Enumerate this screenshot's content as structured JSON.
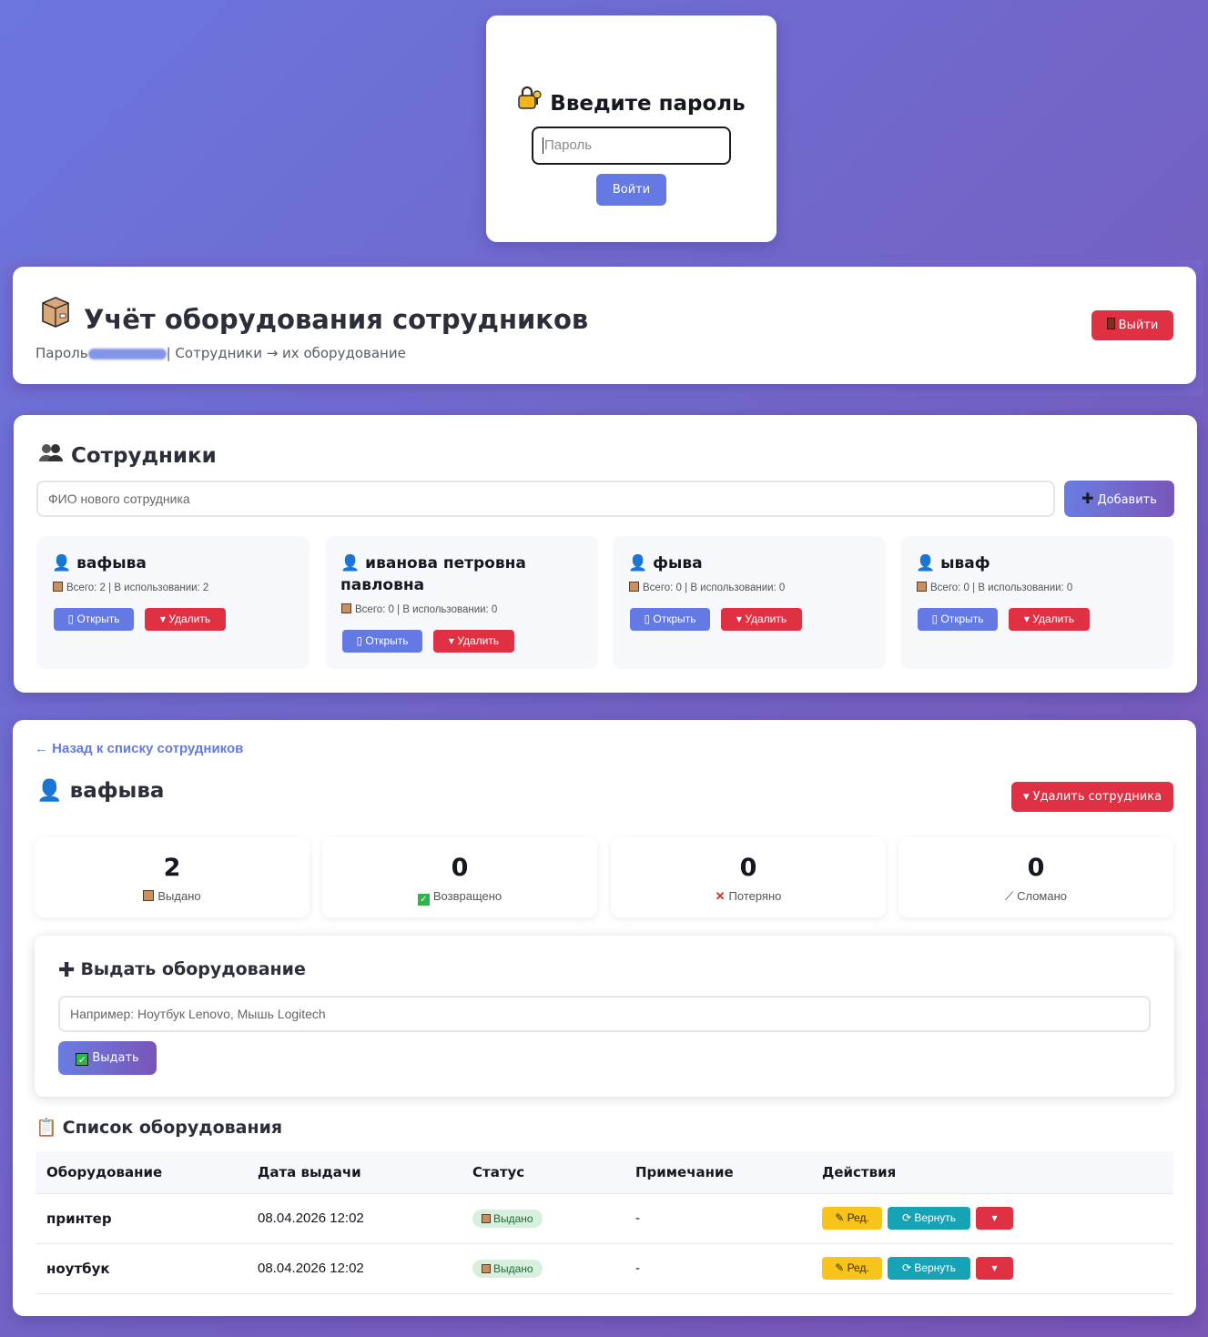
{
  "login": {
    "icon": "lock-key-icon",
    "title": "Введите пароль",
    "password_placeholder": "Пароль",
    "submit_label": "Войти"
  },
  "header": {
    "icon": "package-icon",
    "title": "Учёт оборудования сотрудников",
    "subtitle_prefix": "Пароль",
    "subtitle_suffix": "| Сотрудники → их оборудование",
    "logout_label": "Выйти"
  },
  "employees": {
    "title": "Сотрудники",
    "new_placeholder": "ФИО нового сотрудника",
    "add_label": "Добавить",
    "open_label": "Открыть",
    "delete_label": "Удалить",
    "items": [
      {
        "name": "вафыва",
        "meta": "Всего: 2 | В использовании: 2"
      },
      {
        "name": "иванова петровна павловна",
        "meta": "Всего: 0 | В использовании: 0"
      },
      {
        "name": "фыва",
        "meta": "Всего: 0 | В использовании: 0"
      },
      {
        "name": "ываф",
        "meta": "Всего: 0 | В использовании: 0"
      }
    ]
  },
  "detail": {
    "back_label": "← Назад к списку сотрудников",
    "employee_name": "вафыва",
    "delete_employee_label": "Удалить сотрудника",
    "stats": [
      {
        "value": "2",
        "label": "Выдано",
        "icon": "package-icon"
      },
      {
        "value": "0",
        "label": "Возвращено",
        "icon": "check-icon"
      },
      {
        "value": "0",
        "label": "Потеряно",
        "icon": "cross-icon"
      },
      {
        "value": "0",
        "label": "Сломано",
        "icon": "wrench-icon"
      }
    ],
    "issue": {
      "title": "Выдать оборудование",
      "placeholder": "Например: Ноутбук Lenovo, Мышь Logitech",
      "submit_label": "Выдать"
    },
    "list_title": "Список оборудования",
    "columns": [
      "Оборудование",
      "Дата выдачи",
      "Статус",
      "Примечание",
      "Действия"
    ],
    "rows": [
      {
        "item": "принтер",
        "date": "08.04.2026 12:02",
        "status": "Выдано",
        "note": "-"
      },
      {
        "item": "ноутбук",
        "date": "08.04.2026 12:02",
        "status": "Выдано",
        "note": "-"
      }
    ],
    "edit_label": "Ред.",
    "return_label": "Вернуть"
  }
}
